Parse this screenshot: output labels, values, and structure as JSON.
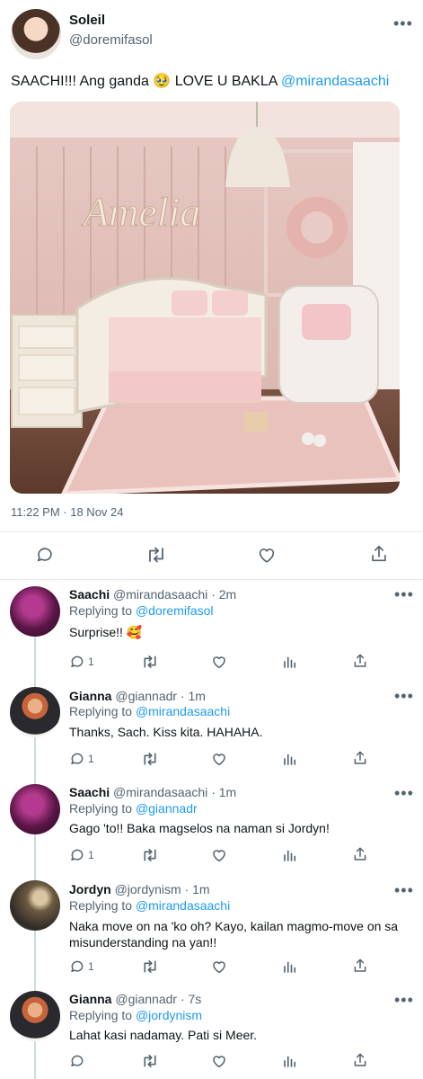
{
  "main": {
    "author_name": "Soleil",
    "author_handle": "@doremifasol",
    "text": "SAACHI!!! Ang ganda 🥹  LOVE U BAKLA ",
    "mention": "@mirandasaachi",
    "image_caption": "Amelia",
    "timestamp": "11:22 PM · 18 Nov 24"
  },
  "replies": [
    {
      "name": "Saachi",
      "handle": "@mirandasaachi",
      "time": "· 2m",
      "replying_label": "Replying to ",
      "replying_to": "@doremifasol",
      "text": "Surprise!! 🥰",
      "reply_count": "1"
    },
    {
      "name": "Gianna",
      "handle": "@giannadr",
      "time": "· 1m",
      "replying_label": "Replying to ",
      "replying_to": "@mirandasaachi",
      "text": "Thanks, Sach. Kiss kita. HAHAHA.",
      "reply_count": "1"
    },
    {
      "name": "Saachi",
      "handle": "@mirandasaachi",
      "time": "· 1m",
      "replying_label": "Replying to ",
      "replying_to": "@giannadr",
      "text": "Gago 'to!! Baka magselos na naman si Jordyn!",
      "reply_count": "1"
    },
    {
      "name": "Jordyn",
      "handle": "@jordynism",
      "time": "· 1m",
      "replying_label": "Replying to ",
      "replying_to": "@mirandasaachi",
      "text_line1": "Naka move on na 'ko oh? Kayo, kailan magmo-move on sa",
      "text_line2": "misunderstanding na yan!!",
      "reply_count": "1"
    },
    {
      "name": "Gianna",
      "handle": "@giannadr",
      "time": "· 7s",
      "replying_label": "Replying to ",
      "replying_to": "@jordynism",
      "text": "Lahat kasi nadamay. Pati si Meer."
    }
  ],
  "icons": {
    "reply": "reply-icon",
    "retweet": "retweet-icon",
    "like": "heart-icon",
    "views": "views-icon",
    "share": "share-icon",
    "more": "more-icon"
  },
  "colors": {
    "link": "#1d9bf0",
    "muted": "#536471",
    "text": "#0f1419",
    "divider": "#e6e9ec"
  }
}
